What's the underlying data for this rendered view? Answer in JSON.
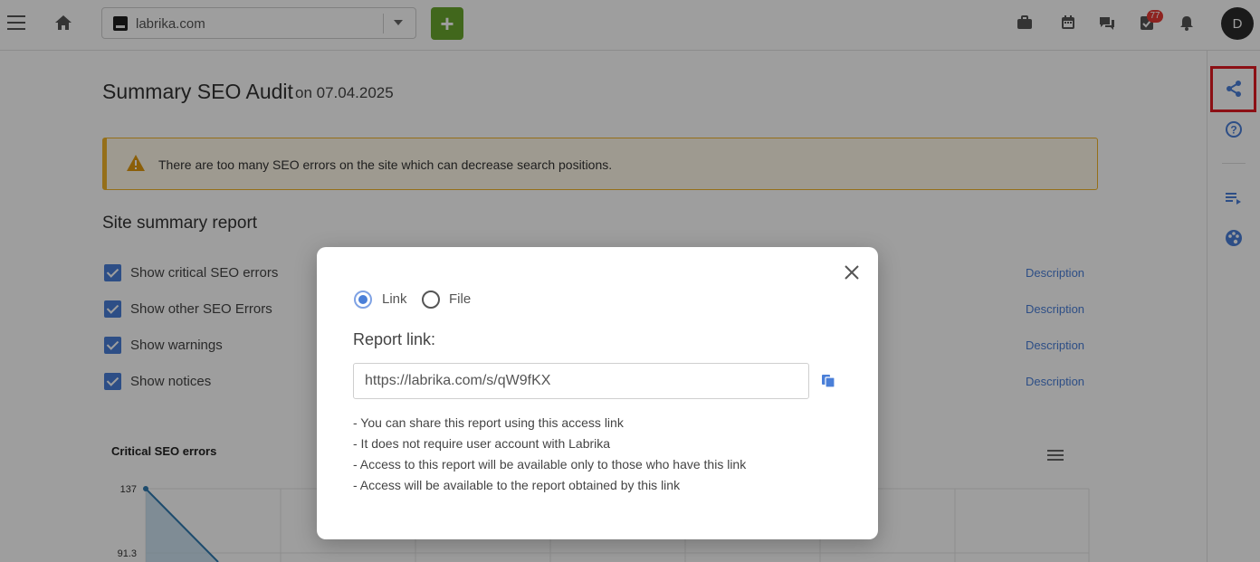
{
  "header": {
    "site": "labrika.com",
    "add_label": "+",
    "tasks_badge": "77",
    "avatar_initial": "D"
  },
  "main": {
    "title": "Summary SEO Audit",
    "date": "on 07.04.2025",
    "alert": "There are too many SEO errors on the site which can decrease search positions.",
    "section_title": "Site summary report",
    "options": [
      {
        "label": "Show critical SEO errors",
        "link": "Description"
      },
      {
        "label": "Show other SEO Errors",
        "link": "Description"
      },
      {
        "label": "Show warnings",
        "link": "Description"
      },
      {
        "label": "Show notices",
        "link": "Description"
      }
    ]
  },
  "chart_data": {
    "type": "line",
    "title": "Critical SEO errors",
    "y_ticks": [
      "137",
      "91.3"
    ],
    "series": [
      {
        "values": [
          137
        ]
      }
    ],
    "grid": true
  },
  "modal": {
    "radio_link": "Link",
    "radio_file": "File",
    "report_label": "Report link:",
    "link_value": "https://labrika.com/s/qW9fKX",
    "notes": [
      "- You can share this report using this access link",
      "- It does not require user account with Labrika",
      "- Access to this report will be available only to those who have this link",
      "- Access will be available to the report obtained by this link"
    ]
  },
  "colors": {
    "accent": "#4a7fd8",
    "add_button": "#6aa72e",
    "warning": "#f0b429",
    "highlight": "#e31b23"
  }
}
